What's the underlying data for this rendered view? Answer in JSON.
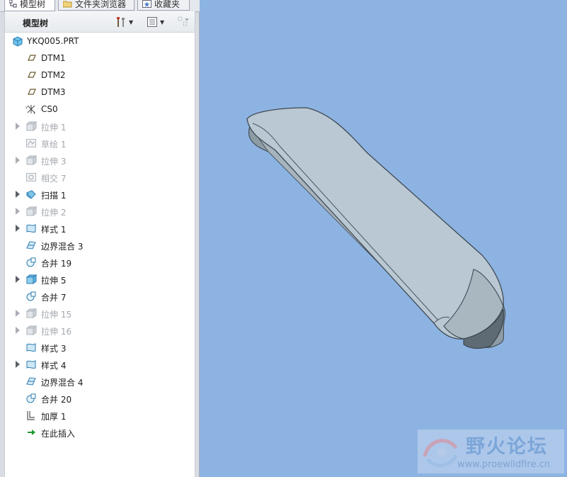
{
  "tabs": [
    {
      "label": "模型树",
      "icon": "tree-icon",
      "active": true
    },
    {
      "label": "文件夹浏览器",
      "icon": "folder-icon",
      "active": false
    },
    {
      "label": "收藏夹",
      "icon": "favorites-icon",
      "active": false
    }
  ],
  "tree": {
    "title": "模型树",
    "toolbar": [
      "settings-icon",
      "show-options-icon",
      "filter-icon"
    ],
    "root": "YKQ005.PRT",
    "items": [
      {
        "label": "DTM1",
        "icon": "datum-plane-icon",
        "expandable": false,
        "dim": false
      },
      {
        "label": "DTM2",
        "icon": "datum-plane-icon",
        "expandable": false,
        "dim": false
      },
      {
        "label": "DTM3",
        "icon": "datum-plane-icon",
        "expandable": false,
        "dim": false
      },
      {
        "label": "CS0",
        "icon": "coordinate-system-icon",
        "expandable": false,
        "dim": false
      },
      {
        "label": "拉伸 1",
        "icon": "extrude-icon",
        "expandable": true,
        "dim": true
      },
      {
        "label": "草绘 1",
        "icon": "sketch-icon",
        "expandable": false,
        "dim": true
      },
      {
        "label": "拉伸 3",
        "icon": "extrude-icon",
        "expandable": true,
        "dim": true
      },
      {
        "label": "相交 7",
        "icon": "intersect-icon",
        "expandable": false,
        "dim": true
      },
      {
        "label": "扫描 1",
        "icon": "sweep-icon",
        "expandable": true,
        "dim": false
      },
      {
        "label": "拉伸 2",
        "icon": "extrude-icon",
        "expandable": true,
        "dim": true
      },
      {
        "label": "样式 1",
        "icon": "style-icon",
        "expandable": true,
        "dim": false
      },
      {
        "label": "边界混合 3",
        "icon": "boundary-blend-icon",
        "expandable": false,
        "dim": false
      },
      {
        "label": "合并 19",
        "icon": "merge-icon",
        "expandable": false,
        "dim": false
      },
      {
        "label": "拉伸 5",
        "icon": "extrude-icon",
        "expandable": true,
        "dim": false
      },
      {
        "label": "合并 7",
        "icon": "merge-icon",
        "expandable": false,
        "dim": false
      },
      {
        "label": "拉伸 15",
        "icon": "extrude-icon",
        "expandable": true,
        "dim": true
      },
      {
        "label": "拉伸 16",
        "icon": "extrude-icon",
        "expandable": true,
        "dim": true
      },
      {
        "label": "样式 3",
        "icon": "style-icon",
        "expandable": false,
        "dim": false
      },
      {
        "label": "样式 4",
        "icon": "style-icon",
        "expandable": true,
        "dim": false
      },
      {
        "label": "边界混合 4",
        "icon": "boundary-blend-icon",
        "expandable": false,
        "dim": false
      },
      {
        "label": "合并 20",
        "icon": "merge-icon",
        "expandable": false,
        "dim": false
      },
      {
        "label": "加厚 1",
        "icon": "thicken-icon",
        "expandable": false,
        "dim": false
      },
      {
        "label": "在此插入",
        "icon": "insert-here-icon",
        "expandable": false,
        "dim": false
      }
    ]
  },
  "watermark": {
    "title": "野火论坛",
    "url": "www.proewildfire.cn"
  },
  "colors": {
    "viewport": "#8db3e2",
    "model": "#b9c8d3",
    "panel": "#ffffff"
  }
}
